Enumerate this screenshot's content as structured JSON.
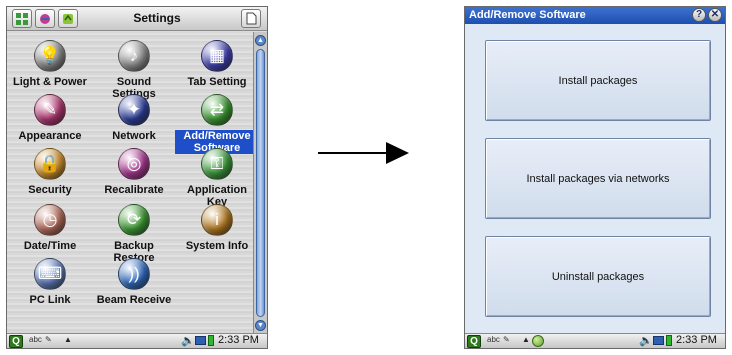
{
  "left_screen": {
    "title": "Settings",
    "icons": [
      {
        "label": "Light & Power",
        "icon": "lightbulb-icon",
        "color": "#8a8a8a"
      },
      {
        "label": "Sound Settings",
        "icon": "guitar-icon",
        "color": "#8f8f8f"
      },
      {
        "label": "Tab Setting",
        "icon": "grid-icon",
        "color": "#3f3fb0"
      },
      {
        "label": "Appearance",
        "icon": "appearance-icon",
        "color": "#b0356f"
      },
      {
        "label": "Network",
        "icon": "network-icon",
        "color": "#2b3d9a"
      },
      {
        "label": "Add/Remove Software",
        "icon": "software-icon",
        "color": "#3b9a32",
        "selected": true
      },
      {
        "label": "Security",
        "icon": "lock-icon",
        "color": "#d0902a"
      },
      {
        "label": "Recalibrate",
        "icon": "target-icon",
        "color": "#a73590"
      },
      {
        "label": "Application Key",
        "icon": "key-icon",
        "color": "#3a9a3a"
      },
      {
        "label": "Date/Time",
        "icon": "clock-icon",
        "color": "#b46a5a"
      },
      {
        "label": "Backup Restore",
        "icon": "backup-icon",
        "color": "#3b9a32"
      },
      {
        "label": "System Info",
        "icon": "info-icon",
        "color": "#b57b1f"
      },
      {
        "label": "PC Link",
        "icon": "pc-link-icon",
        "color": "#5a78b8"
      },
      {
        "label": "Beam Receive",
        "icon": "beam-icon",
        "color": "#2f6ac0"
      }
    ],
    "status_bar": {
      "input_mode": "abc",
      "time": "2:33 PM"
    }
  },
  "right_screen": {
    "title": "Add/Remove Software",
    "help_label": "?",
    "close_label": "✕",
    "buttons": [
      {
        "label": "Install packages"
      },
      {
        "label": "Install packages via networks"
      },
      {
        "label": "Uninstall packages"
      }
    ],
    "status_bar": {
      "input_mode": "abc",
      "time": "2:33 PM"
    }
  }
}
